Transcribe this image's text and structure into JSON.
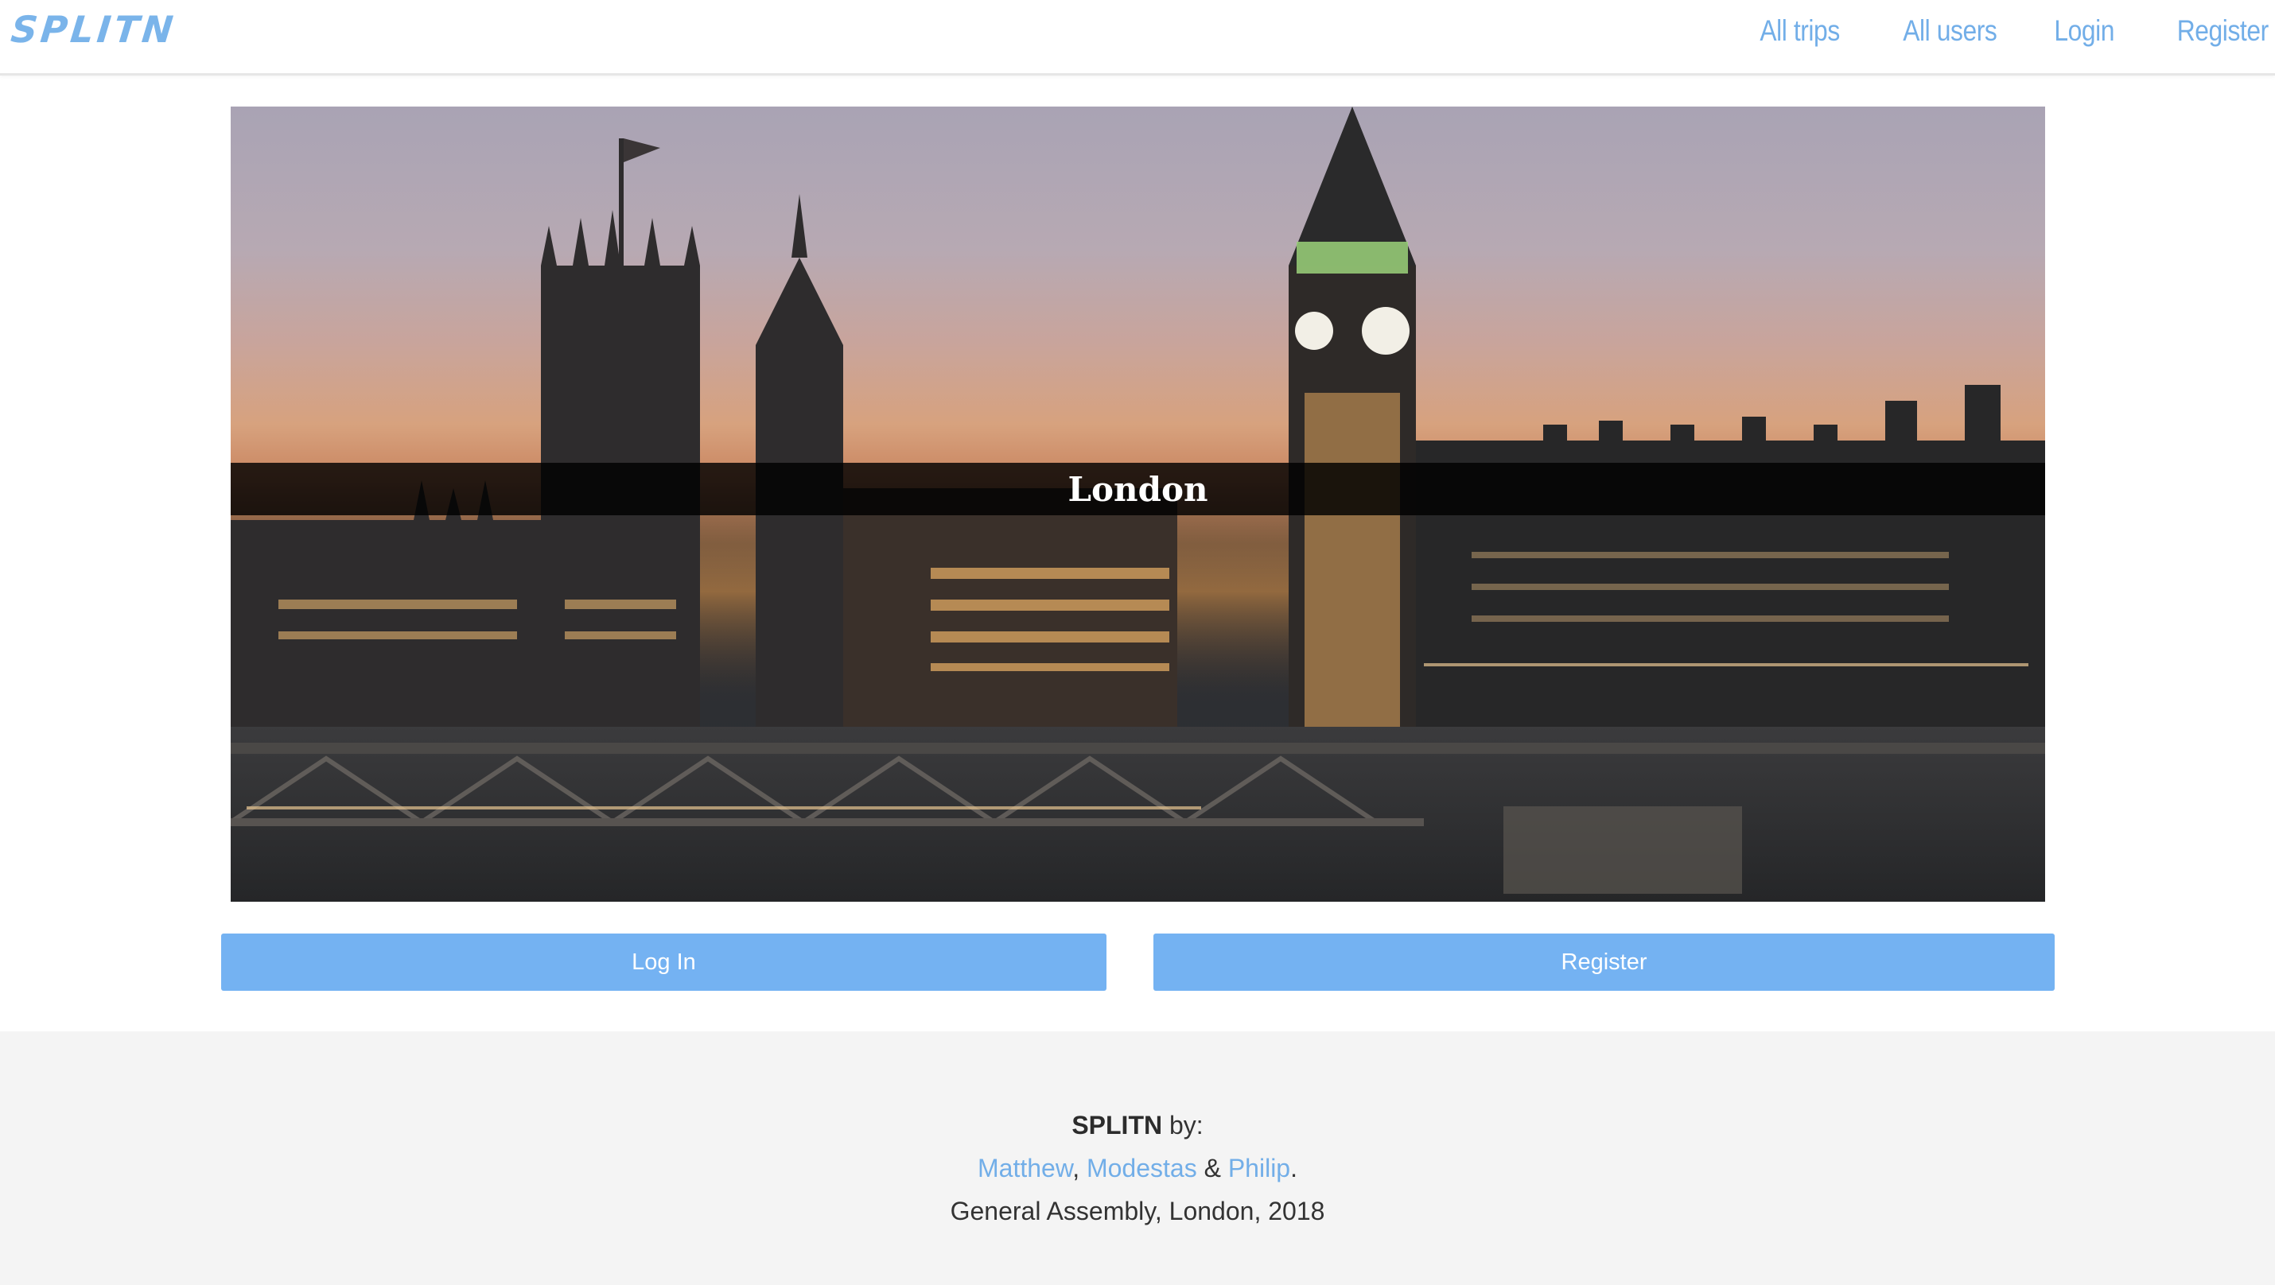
{
  "navbar": {
    "brand": "SPLITN",
    "links": [
      "All trips",
      "All users",
      "Login",
      "Register"
    ]
  },
  "hero": {
    "title": "London"
  },
  "actions": {
    "login_label": "Log In",
    "register_label": "Register"
  },
  "footer": {
    "brand": "SPLITN",
    "by_text": " by:",
    "authors": [
      "Matthew",
      "Modestas",
      "Philip"
    ],
    "sep1": ", ",
    "sep2": " & ",
    "end": ".",
    "credit": "General Assembly, London, 2018"
  },
  "colors": {
    "accent": "#74b2f2",
    "link": "#72aee8",
    "footer_bg": "#f4f4f4"
  }
}
